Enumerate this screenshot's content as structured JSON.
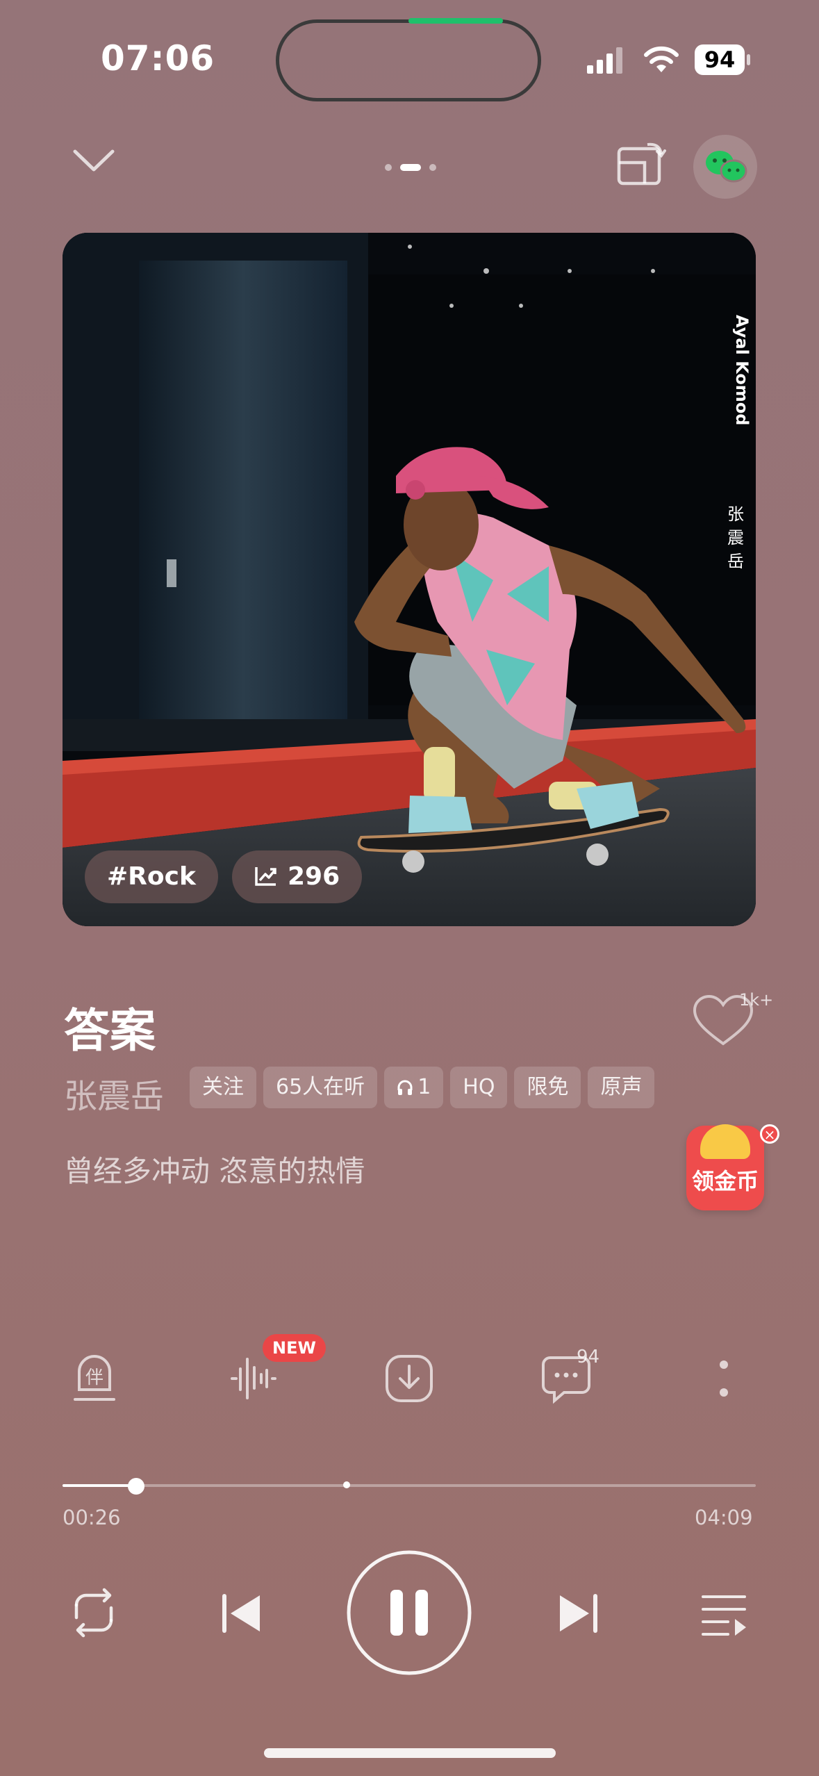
{
  "status_bar": {
    "time": "07:06",
    "battery": "94"
  },
  "song": {
    "title": "答案",
    "artist": "张震岳",
    "lyric": "曾经多冲动 恣意的热情",
    "like_count": "1k+"
  },
  "album_art": {
    "photographer_credit": "Ayal Komod",
    "artist_vertical": [
      "张",
      "震",
      "岳"
    ],
    "genre_tag": "#Rock",
    "trend_count": "296"
  },
  "chips": {
    "follow": "关注",
    "listeners": "65人在听",
    "headphones": "1",
    "quality": "HQ",
    "free": "限免",
    "original": "原声"
  },
  "coin_badge": {
    "label": "领金币"
  },
  "actions": {
    "new_badge": "NEW",
    "comment_count": "94",
    "accompany_label": "伴"
  },
  "playback": {
    "current_time": "00:26",
    "total_time": "04:09",
    "progress": 0.106,
    "buffered": 0.41
  },
  "colors": {
    "accent_green": "#1fc06b",
    "badge_red": "#ea4647",
    "coin_gold": "#f9c946"
  }
}
